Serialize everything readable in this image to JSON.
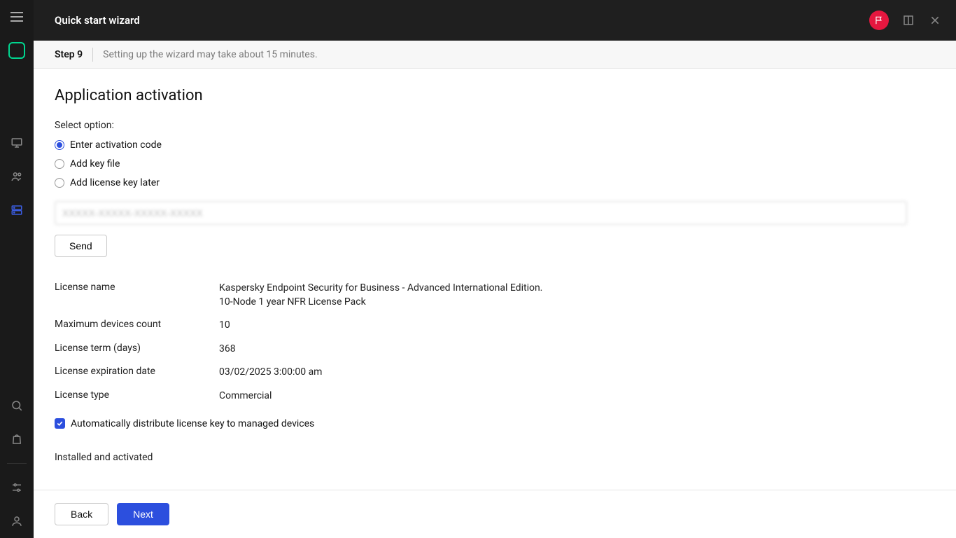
{
  "header": {
    "title": "Quick start wizard"
  },
  "stepbar": {
    "step": "Step 9",
    "hint": "Setting up the wizard may take about 15 minutes."
  },
  "page": {
    "heading": "Application activation",
    "select_option_label": "Select option:"
  },
  "radios": {
    "enter_code": "Enter activation code",
    "add_key_file": "Add key file",
    "add_later": "Add license key later"
  },
  "code_input": {
    "value": "XXXXX-XXXXX-XXXXX-XXXXX"
  },
  "buttons": {
    "send": "Send",
    "back": "Back",
    "next": "Next"
  },
  "license": {
    "name_label": "License name",
    "name_value_line1": "Kaspersky Endpoint Security for Business - Advanced International Edition.",
    "name_value_line2": "10-Node 1 year NFR License Pack",
    "max_devices_label": "Maximum devices count",
    "max_devices_value": "10",
    "term_label": "License term (days)",
    "term_value": "368",
    "expiry_label": "License expiration date",
    "expiry_value": "03/02/2025 3:00:00 am",
    "type_label": "License type",
    "type_value": "Commercial"
  },
  "checkbox": {
    "auto_distribute": "Automatically distribute license key to managed devices"
  },
  "status": {
    "message": "Installed and activated"
  }
}
